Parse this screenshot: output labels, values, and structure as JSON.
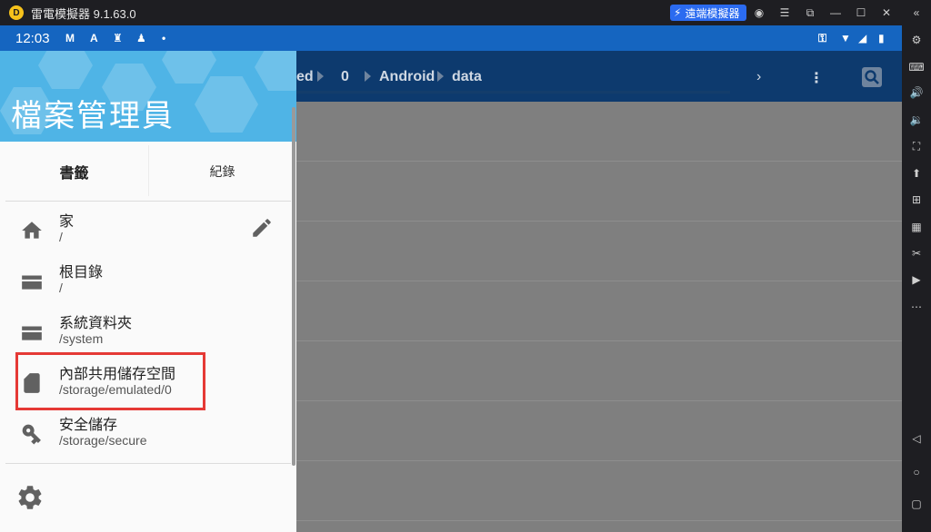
{
  "emulator": {
    "title": "雷電模擬器 9.1.63.0",
    "remote_button": "遠端模擬器"
  },
  "statusbar": {
    "time": "12:03"
  },
  "background": {
    "breadcrumbs": [
      "ed",
      "0",
      "Android",
      "data"
    ]
  },
  "drawer": {
    "title": "檔案管理員",
    "tabs": [
      "書籤",
      "紀錄"
    ],
    "items": [
      {
        "label": "家",
        "path": "/"
      },
      {
        "label": "根目錄",
        "path": "/"
      },
      {
        "label": "系統資料夾",
        "path": "/system"
      },
      {
        "label": "內部共用儲存空間",
        "path": "/storage/emulated/0"
      },
      {
        "label": "安全儲存",
        "path": "/storage/secure"
      }
    ]
  },
  "colors": {
    "status_bar": "#1565c0",
    "drawer_header": "#4fb4e6",
    "highlight": "#e53935"
  }
}
